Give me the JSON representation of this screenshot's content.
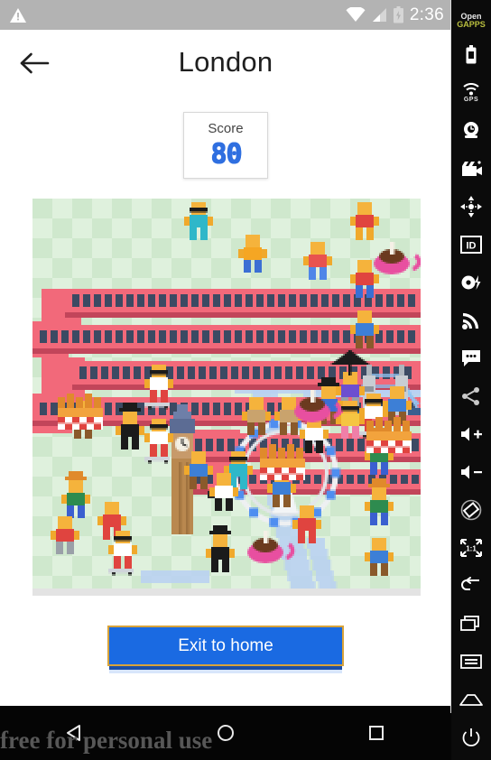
{
  "status_bar": {
    "warning_icon": "warning-triangle-icon",
    "wifi_icon": "wifi-icon",
    "signal_icon": "cell-signal-icon",
    "battery_icon": "battery-icon",
    "time": "2:36"
  },
  "app_bar": {
    "back_icon": "arrow-left-icon",
    "title": "London"
  },
  "score": {
    "label": "Score",
    "value": "80",
    "value_color": "#2f6fe0"
  },
  "map": {
    "name": "game-map",
    "background_color": "#dff1dd",
    "checker_color": "#cfe8cd",
    "river_color": "#b9d0f2",
    "snake_body_color": "#f2697a",
    "snake_window_color": "#3c4a63",
    "snake_dark_color": "#c2455a",
    "landmarks": [
      "big-ben",
      "london-eye",
      "tower-bridge"
    ],
    "items": [
      "picnic-basket",
      "teacup",
      "skateboard",
      "umbrella"
    ]
  },
  "exit_button": {
    "label": "Exit to home",
    "background": "#1a6ae2",
    "border": "#d8a33a",
    "shadow": "#1b4fa8"
  },
  "nav_bar": {
    "back_icon": "triangle-back-icon",
    "home_icon": "circle-home-icon",
    "recents_icon": "square-recents-icon",
    "watermark": "free for personal use"
  },
  "emulator_toolbar": {
    "logo_line1": "Open",
    "logo_line2": "GAPPS",
    "items": [
      {
        "name": "battery-icon",
        "caption": ""
      },
      {
        "name": "gps-icon",
        "caption": "GPS"
      },
      {
        "name": "camera-icon",
        "caption": ""
      },
      {
        "name": "video-record-icon",
        "caption": ""
      },
      {
        "name": "move-dpad-icon",
        "caption": ""
      },
      {
        "name": "id-icon",
        "caption": ""
      },
      {
        "name": "flash-record-icon",
        "caption": ""
      },
      {
        "name": "rss-signal-icon",
        "caption": ""
      },
      {
        "name": "sms-message-icon",
        "caption": ""
      },
      {
        "name": "share-icon",
        "caption": ""
      },
      {
        "name": "volume-up-icon",
        "caption": ""
      },
      {
        "name": "volume-down-icon",
        "caption": ""
      },
      {
        "name": "rotate-screen-icon",
        "caption": ""
      },
      {
        "name": "zoom-actual-size-icon",
        "caption": "1:1"
      },
      {
        "name": "back-arrow-icon",
        "caption": ""
      },
      {
        "name": "recents-icon",
        "caption": ""
      },
      {
        "name": "menu-icon",
        "caption": ""
      },
      {
        "name": "home-icon",
        "caption": ""
      },
      {
        "name": "power-icon",
        "caption": ""
      }
    ]
  }
}
